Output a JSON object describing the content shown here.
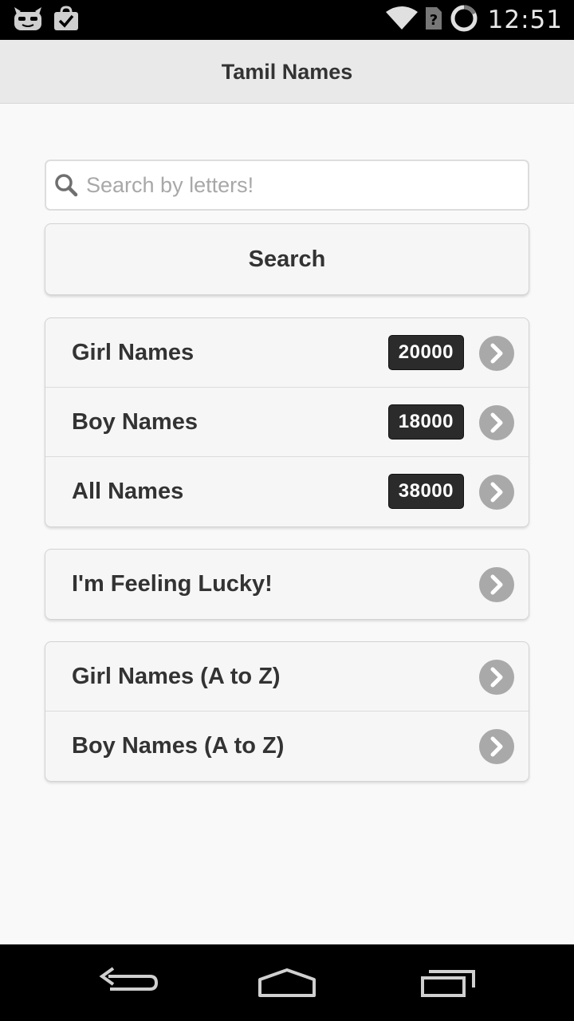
{
  "status_bar": {
    "time": "12:51",
    "icons": [
      "cyanogen-mascot-icon",
      "shopping-bag-check-icon",
      "wifi-icon",
      "no-sim-icon",
      "sync-ring-icon"
    ]
  },
  "header": {
    "title": "Tamil Names"
  },
  "search": {
    "placeholder": "Search by letters!",
    "value": "",
    "button_label": "Search"
  },
  "categories": [
    {
      "label": "Girl Names",
      "count": "20000"
    },
    {
      "label": "Boy Names",
      "count": "18000"
    },
    {
      "label": "All Names",
      "count": "38000"
    }
  ],
  "lucky": {
    "label": "I'm Feeling Lucky!"
  },
  "alphabetical": [
    {
      "label": "Girl Names (A to Z)"
    },
    {
      "label": "Boy Names (A to Z)"
    }
  ],
  "nav_bar": {
    "icons": [
      "back-icon",
      "home-icon",
      "recent-apps-icon"
    ]
  },
  "colors": {
    "header_bg": "#e9e9e9",
    "badge_bg": "#2b2b2b",
    "chevron_bg": "#a9a9a9",
    "page_bg": "#f9f9f9"
  }
}
